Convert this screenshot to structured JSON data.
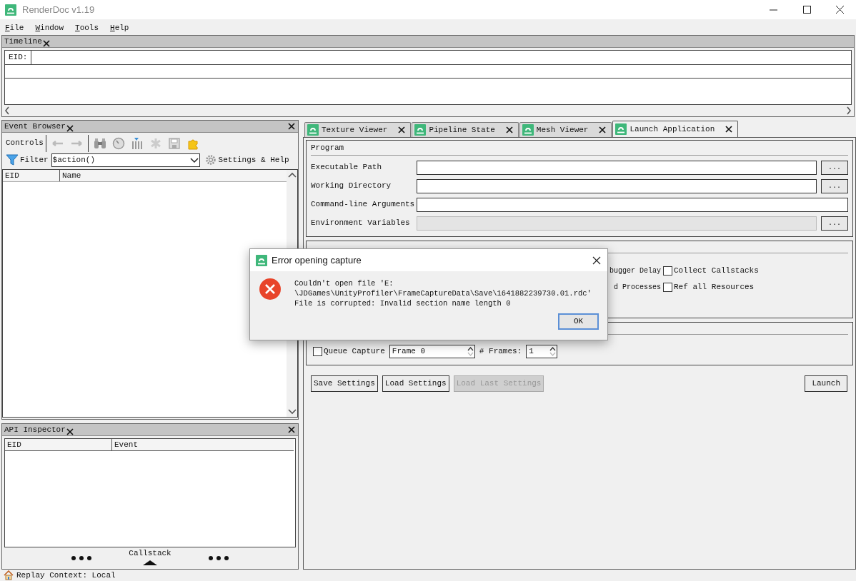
{
  "window": {
    "title": "RenderDoc v1.19"
  },
  "menu": [
    {
      "label": "File"
    },
    {
      "label": "Window"
    },
    {
      "label": "Tools"
    },
    {
      "label": "Help"
    }
  ],
  "timeline": {
    "title": "Timeline",
    "eid_label": "EID:"
  },
  "event_browser": {
    "title": "Event Browser",
    "controls_label": "Controls",
    "filter_label": "Filter",
    "filter_value": "$action()",
    "settings_label": "Settings & Help",
    "columns": [
      "EID",
      "Name"
    ]
  },
  "api_inspector": {
    "title": "API Inspector",
    "columns": [
      "EID",
      "Event"
    ],
    "callstack_label": "Callstack"
  },
  "tabs": [
    {
      "label": "Texture Viewer",
      "selected": false
    },
    {
      "label": "Pipeline State",
      "selected": false
    },
    {
      "label": "Mesh Viewer",
      "selected": false
    },
    {
      "label": "Launch Application",
      "selected": true
    }
  ],
  "program": {
    "title": "Program",
    "fields": [
      {
        "label": "Executable Path",
        "kind": "browse",
        "disabled": false,
        "button": "..."
      },
      {
        "label": "Working Directory",
        "kind": "browse",
        "disabled": false,
        "button": "..."
      },
      {
        "label": "Command-line Arguments",
        "kind": "text",
        "disabled": false
      },
      {
        "label": "Environment Variables",
        "kind": "browse",
        "disabled": true,
        "button": "..."
      }
    ]
  },
  "capture_options": {
    "rows": [
      {
        "fragment": "bugger Delay",
        "option": {
          "label": "Collect Callstacks",
          "checked": false
        }
      },
      {
        "fragment": "d Processes",
        "option": {
          "label": "Ref all Resources",
          "checked": false
        }
      }
    ]
  },
  "actions": {
    "queue_capture": {
      "label": "Queue Capture",
      "checked": false
    },
    "frame_value": "Frame 0",
    "frames_label": "# Frames:",
    "frames_value": "1"
  },
  "buttons": [
    {
      "label": "Save Settings",
      "disabled": false
    },
    {
      "label": "Load Settings",
      "disabled": false
    },
    {
      "label": "Load Last Settings",
      "disabled": true
    }
  ],
  "launch_button": "Launch",
  "status_bar": {
    "text": "Replay Context: Local"
  },
  "dialog": {
    "title": "Error opening capture",
    "lines": [
      "Couldn't open file 'E:",
      "\\JDGames\\UnityProfiler\\FrameCaptureData\\Save\\1641882239730.01.rdc'",
      "File is corrupted: Invalid section name length 0"
    ],
    "button": "OK"
  }
}
